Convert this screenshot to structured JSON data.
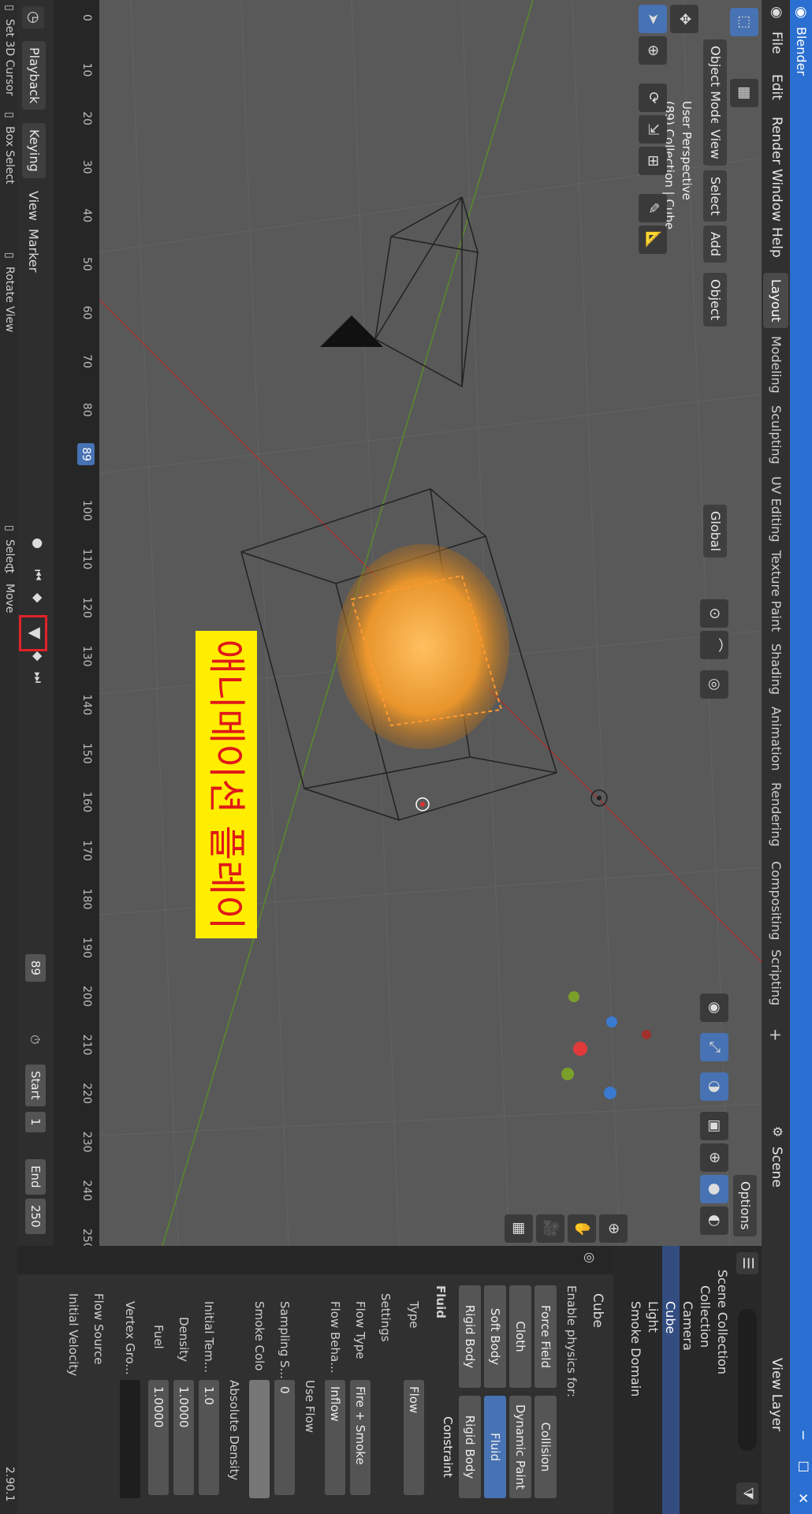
{
  "app": {
    "title": "Blender",
    "version": "2.90.1"
  },
  "menu": [
    "File",
    "Edit",
    "Render",
    "Window",
    "Help"
  ],
  "workspaces": [
    "Layout",
    "Modeling",
    "Sculpting",
    "UV Editing",
    "Texture Paint",
    "Shading",
    "Animation",
    "Rendering",
    "Compositing",
    "Scripting"
  ],
  "scene": {
    "label": "Scene",
    "view_layer": "View Layer"
  },
  "viewport": {
    "mode": "Object Mode",
    "menus": [
      "View",
      "Select",
      "Add",
      "Object"
    ],
    "orientation": "Global",
    "options": "Options",
    "info_line1": "User Perspective",
    "info_line2": "(89) Collection | Cube",
    "overlay_text": "애니메이션 플레이",
    "axis_x": "X",
    "axis_y": "Y",
    "axis_z": "Z"
  },
  "timeline": {
    "menus": [
      "Playback",
      "Keying",
      "View",
      "Marker"
    ],
    "current_frame": "89",
    "frame_field": "89",
    "start_label": "Start",
    "start_value": "1",
    "end_label": "End",
    "end_value": "250",
    "ticks": [
      "0",
      "10",
      "20",
      "30",
      "40",
      "50",
      "60",
      "70",
      "80",
      "90",
      "100",
      "110",
      "120",
      "130",
      "140",
      "150",
      "160",
      "170",
      "180",
      "190",
      "200",
      "210",
      "220",
      "230",
      "240",
      "250"
    ]
  },
  "status": {
    "set_cursor": "Set 3D Cursor",
    "box_select": "Box Select",
    "rotate_view": "Rotate View",
    "select": "Select",
    "move": "Move",
    "version": "2.90.1"
  },
  "outliner": {
    "items": [
      "Scene Collection",
      "Collection",
      "Camera",
      "Cube",
      "Light",
      "Smoke Domain"
    ],
    "selected": "Cube"
  },
  "properties": {
    "object_name": "Cube",
    "enable_physics": "Enable physics for:",
    "physics_buttons": [
      [
        "Force Field",
        "Collision"
      ],
      [
        "Cloth",
        "Dynamic Paint"
      ],
      [
        "Soft Body",
        "Fluid"
      ],
      [
        "Rigid Body",
        "Rigid Body Constraint"
      ]
    ],
    "fluid_panel": "Fluid",
    "type_label": "Type",
    "type_value": "Flow",
    "settings_label": "Settings",
    "flow_type_label": "Flow Type",
    "flow_type_value": "Fire + Smoke",
    "flow_behavior_label": "Flow Beha...",
    "flow_behavior_value": "Inflow",
    "use_flow": "Use Flow",
    "sampling_label": "Sampling S...",
    "sampling_value": "0",
    "smoke_color_label": "Smoke Colo",
    "absolute_density": "Absolute Density",
    "initial_temp_label": "Initial Tem...",
    "initial_temp_value": "1.0",
    "density_label": "Density",
    "density_value": "1.0000",
    "fuel_label": "Fuel",
    "fuel_value": "1.0000",
    "vertex_group_label": "Vertex Gro...",
    "flow_source": "Flow Source",
    "initial_velocity": "Initial Velocity"
  },
  "colors": {
    "accent": "#4772b3",
    "titlebar": "#2a6fd1",
    "highlight": "#ffee00",
    "marker": "#e0222a",
    "fire": "#e8952c"
  }
}
